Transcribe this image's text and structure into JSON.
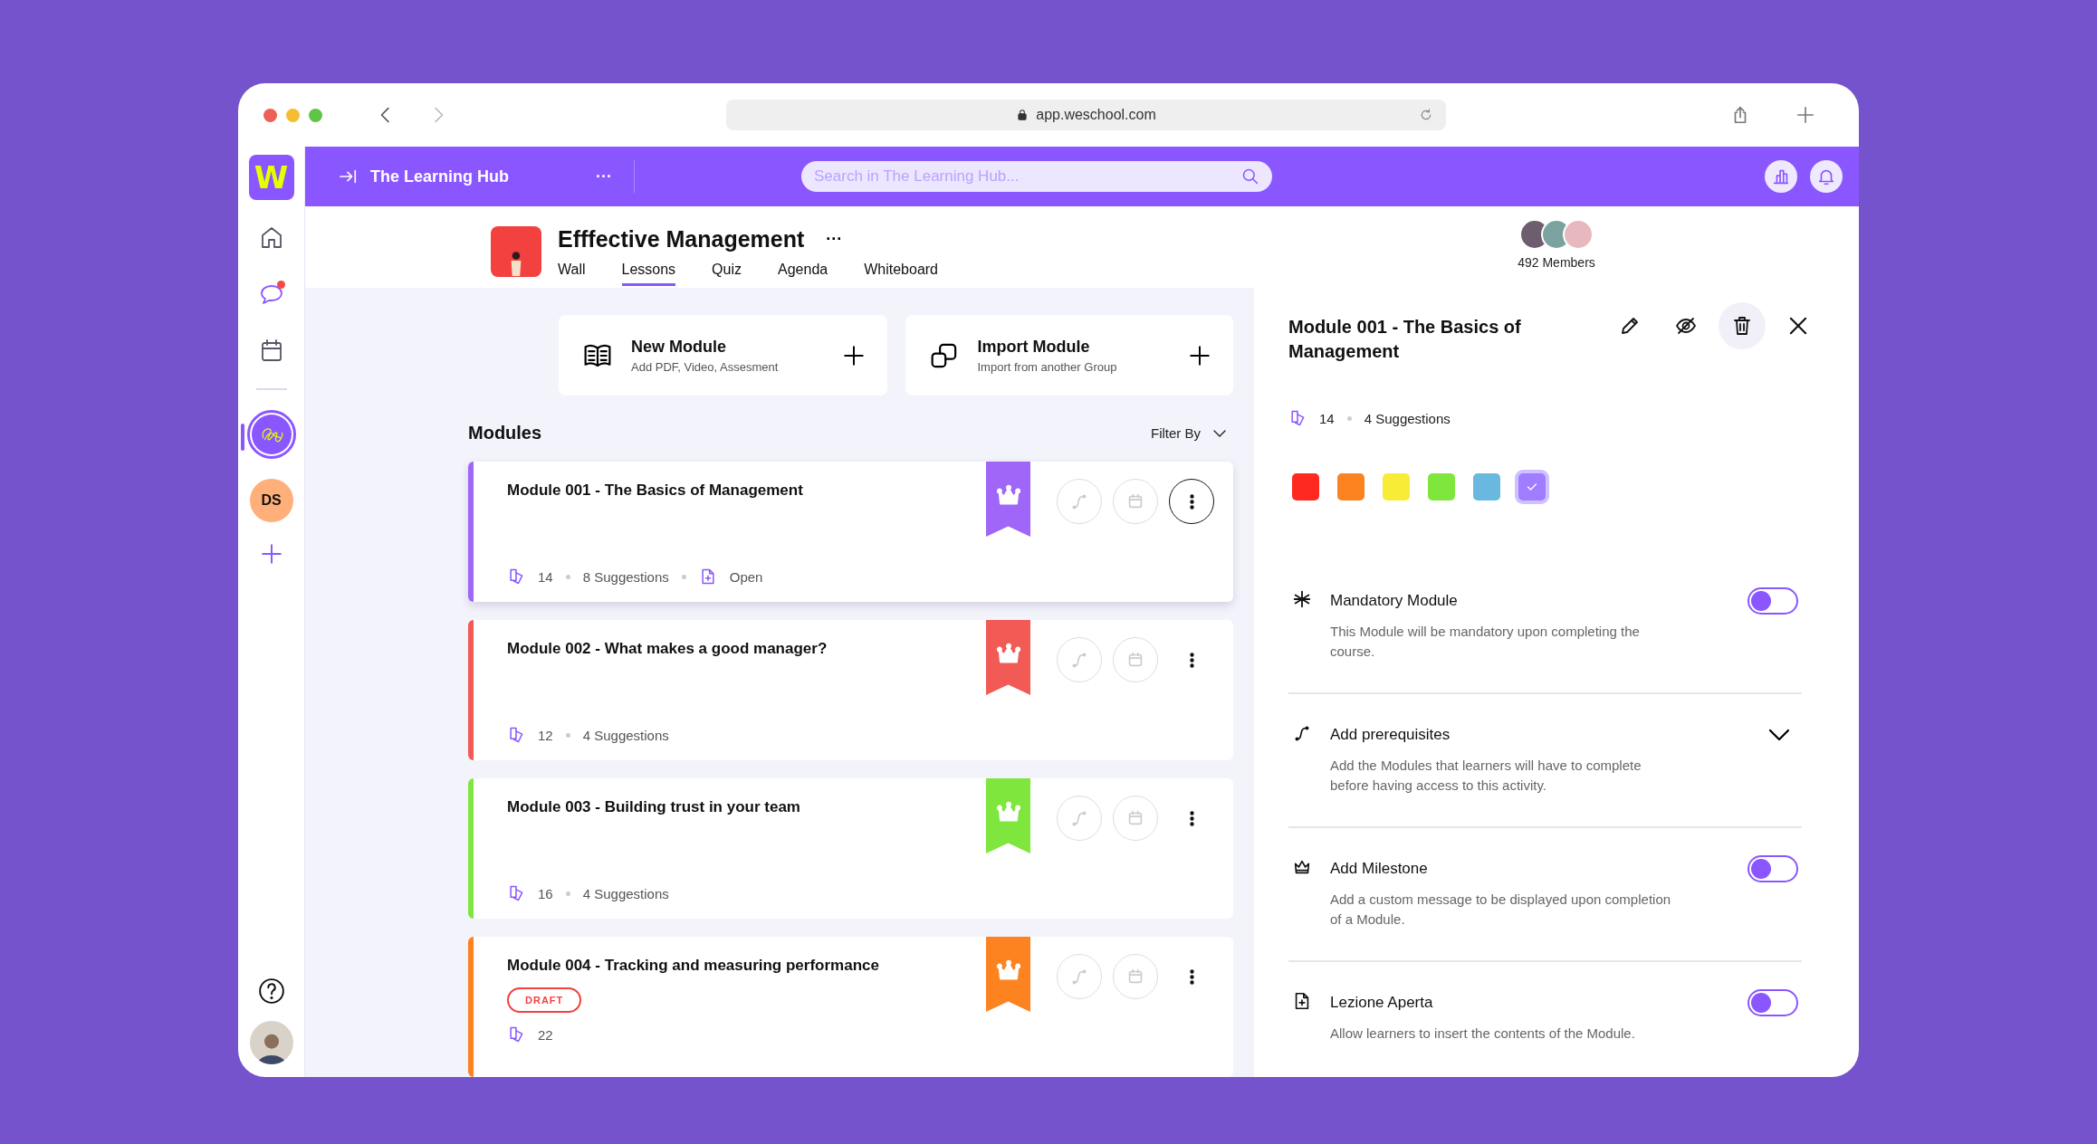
{
  "browser": {
    "url": "app.weschool.com"
  },
  "sidebar": {
    "logo": "W",
    "nav": [
      {
        "kind": "home",
        "notification": false
      },
      {
        "kind": "chat",
        "notification": true
      },
      {
        "kind": "calendar",
        "notification": false
      }
    ],
    "spaces": [
      {
        "kind": "image",
        "selected": true
      },
      {
        "kind": "initials",
        "label": "DS",
        "selected": false
      }
    ]
  },
  "topbar": {
    "title": "The Learning Hub",
    "more": "···",
    "search": {
      "placeholder": "Search in The Learning Hub..."
    }
  },
  "group": {
    "title": "Efffective Management",
    "more": "···",
    "tabs": [
      {
        "label": "Wall",
        "selected": false
      },
      {
        "label": "Lessons",
        "selected": true
      },
      {
        "label": "Quiz",
        "selected": false
      },
      {
        "label": "Agenda",
        "selected": false
      },
      {
        "label": "Whiteboard",
        "selected": false
      }
    ],
    "members": "492 Members"
  },
  "actions": [
    {
      "kind": "new",
      "title": "New Module",
      "subtitle": "Add PDF, Video, Assesment"
    },
    {
      "kind": "import",
      "title": "Import Module",
      "subtitle": "Import from another Group"
    }
  ],
  "modules": {
    "title": "Modules",
    "filter": "Filter By",
    "items": [
      {
        "title": "Module 001 - The Basics of Management",
        "color": "#a066f7",
        "lessons": "14",
        "suggestions": "8 Suggestions",
        "open": "Open",
        "selected": true
      },
      {
        "title": "Module 002 - What makes a good manager?",
        "color": "#f25a55",
        "lessons": "12",
        "suggestions": "4 Suggestions",
        "selected": false
      },
      {
        "title": "Module 003 - Building trust in your team",
        "color": "#7ee63c",
        "lessons": "16",
        "suggestions": "4 Suggestions",
        "selected": false
      },
      {
        "title": "Module 004 - Tracking and measuring performance",
        "color": "#fd8220",
        "draft": "DRAFT",
        "lessons": "22",
        "selected": false
      }
    ]
  },
  "panel": {
    "title": "Module 001 - The Basics of Management",
    "lessons": "14",
    "suggestions": "4 Suggestions",
    "colors": [
      {
        "color": "#ff2a1f",
        "selected": false
      },
      {
        "color": "#fd8220",
        "selected": false
      },
      {
        "color": "#f8ec37",
        "selected": false
      },
      {
        "color": "#7ee63c",
        "selected": false
      },
      {
        "color": "#68b8e0",
        "selected": false
      },
      {
        "color": "#a07cff",
        "selected": true
      }
    ],
    "settings": [
      {
        "kind": "toggle",
        "title": "Mandatory Module",
        "description": "This Module will be mandatory upon completing the course.",
        "on": false
      },
      {
        "kind": "expand",
        "title": "Add prerequisites",
        "description": "Add the Modules that learners will have to complete before having access to this activity.",
        "expanded": false
      },
      {
        "kind": "toggle",
        "title": "Add Milestone",
        "description": "Add a custom message to be displayed upon completion of a Module.",
        "on": false
      },
      {
        "kind": "toggle",
        "title": "Lezione Aperta",
        "description": "Allow learners to insert the contents of the Module.",
        "on": false
      }
    ]
  }
}
